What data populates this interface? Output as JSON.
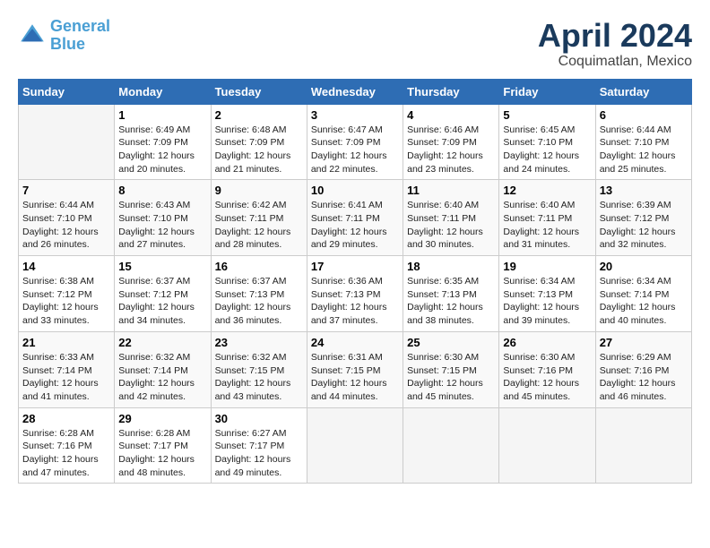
{
  "header": {
    "logo_line1": "General",
    "logo_line2": "Blue",
    "month": "April 2024",
    "location": "Coquimatlan, Mexico"
  },
  "weekdays": [
    "Sunday",
    "Monday",
    "Tuesday",
    "Wednesday",
    "Thursday",
    "Friday",
    "Saturday"
  ],
  "weeks": [
    [
      {
        "day": "",
        "info": ""
      },
      {
        "day": "1",
        "info": "Sunrise: 6:49 AM\nSunset: 7:09 PM\nDaylight: 12 hours\nand 20 minutes."
      },
      {
        "day": "2",
        "info": "Sunrise: 6:48 AM\nSunset: 7:09 PM\nDaylight: 12 hours\nand 21 minutes."
      },
      {
        "day": "3",
        "info": "Sunrise: 6:47 AM\nSunset: 7:09 PM\nDaylight: 12 hours\nand 22 minutes."
      },
      {
        "day": "4",
        "info": "Sunrise: 6:46 AM\nSunset: 7:09 PM\nDaylight: 12 hours\nand 23 minutes."
      },
      {
        "day": "5",
        "info": "Sunrise: 6:45 AM\nSunset: 7:10 PM\nDaylight: 12 hours\nand 24 minutes."
      },
      {
        "day": "6",
        "info": "Sunrise: 6:44 AM\nSunset: 7:10 PM\nDaylight: 12 hours\nand 25 minutes."
      }
    ],
    [
      {
        "day": "7",
        "info": "Sunrise: 6:44 AM\nSunset: 7:10 PM\nDaylight: 12 hours\nand 26 minutes."
      },
      {
        "day": "8",
        "info": "Sunrise: 6:43 AM\nSunset: 7:10 PM\nDaylight: 12 hours\nand 27 minutes."
      },
      {
        "day": "9",
        "info": "Sunrise: 6:42 AM\nSunset: 7:11 PM\nDaylight: 12 hours\nand 28 minutes."
      },
      {
        "day": "10",
        "info": "Sunrise: 6:41 AM\nSunset: 7:11 PM\nDaylight: 12 hours\nand 29 minutes."
      },
      {
        "day": "11",
        "info": "Sunrise: 6:40 AM\nSunset: 7:11 PM\nDaylight: 12 hours\nand 30 minutes."
      },
      {
        "day": "12",
        "info": "Sunrise: 6:40 AM\nSunset: 7:11 PM\nDaylight: 12 hours\nand 31 minutes."
      },
      {
        "day": "13",
        "info": "Sunrise: 6:39 AM\nSunset: 7:12 PM\nDaylight: 12 hours\nand 32 minutes."
      }
    ],
    [
      {
        "day": "14",
        "info": "Sunrise: 6:38 AM\nSunset: 7:12 PM\nDaylight: 12 hours\nand 33 minutes."
      },
      {
        "day": "15",
        "info": "Sunrise: 6:37 AM\nSunset: 7:12 PM\nDaylight: 12 hours\nand 34 minutes."
      },
      {
        "day": "16",
        "info": "Sunrise: 6:37 AM\nSunset: 7:13 PM\nDaylight: 12 hours\nand 36 minutes."
      },
      {
        "day": "17",
        "info": "Sunrise: 6:36 AM\nSunset: 7:13 PM\nDaylight: 12 hours\nand 37 minutes."
      },
      {
        "day": "18",
        "info": "Sunrise: 6:35 AM\nSunset: 7:13 PM\nDaylight: 12 hours\nand 38 minutes."
      },
      {
        "day": "19",
        "info": "Sunrise: 6:34 AM\nSunset: 7:13 PM\nDaylight: 12 hours\nand 39 minutes."
      },
      {
        "day": "20",
        "info": "Sunrise: 6:34 AM\nSunset: 7:14 PM\nDaylight: 12 hours\nand 40 minutes."
      }
    ],
    [
      {
        "day": "21",
        "info": "Sunrise: 6:33 AM\nSunset: 7:14 PM\nDaylight: 12 hours\nand 41 minutes."
      },
      {
        "day": "22",
        "info": "Sunrise: 6:32 AM\nSunset: 7:14 PM\nDaylight: 12 hours\nand 42 minutes."
      },
      {
        "day": "23",
        "info": "Sunrise: 6:32 AM\nSunset: 7:15 PM\nDaylight: 12 hours\nand 43 minutes."
      },
      {
        "day": "24",
        "info": "Sunrise: 6:31 AM\nSunset: 7:15 PM\nDaylight: 12 hours\nand 44 minutes."
      },
      {
        "day": "25",
        "info": "Sunrise: 6:30 AM\nSunset: 7:15 PM\nDaylight: 12 hours\nand 45 minutes."
      },
      {
        "day": "26",
        "info": "Sunrise: 6:30 AM\nSunset: 7:16 PM\nDaylight: 12 hours\nand 45 minutes."
      },
      {
        "day": "27",
        "info": "Sunrise: 6:29 AM\nSunset: 7:16 PM\nDaylight: 12 hours\nand 46 minutes."
      }
    ],
    [
      {
        "day": "28",
        "info": "Sunrise: 6:28 AM\nSunset: 7:16 PM\nDaylight: 12 hours\nand 47 minutes."
      },
      {
        "day": "29",
        "info": "Sunrise: 6:28 AM\nSunset: 7:17 PM\nDaylight: 12 hours\nand 48 minutes."
      },
      {
        "day": "30",
        "info": "Sunrise: 6:27 AM\nSunset: 7:17 PM\nDaylight: 12 hours\nand 49 minutes."
      },
      {
        "day": "",
        "info": ""
      },
      {
        "day": "",
        "info": ""
      },
      {
        "day": "",
        "info": ""
      },
      {
        "day": "",
        "info": ""
      }
    ]
  ]
}
